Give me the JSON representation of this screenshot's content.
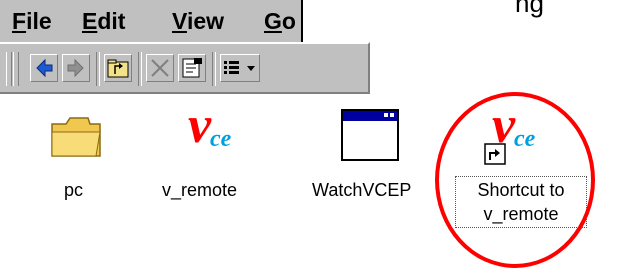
{
  "corner_text": "ng",
  "menu": {
    "items": [
      {
        "label_acc": "F",
        "label_rest": "ile"
      },
      {
        "label_acc": "E",
        "label_rest": "dit"
      },
      {
        "label_acc": "V",
        "label_rest": "iew"
      },
      {
        "label_acc": "G",
        "label_rest": "o"
      }
    ]
  },
  "toolbar": {
    "buttons": [
      "back-icon",
      "forward-icon",
      "up-folder-icon",
      "delete-icon",
      "properties-icon",
      "views-icon"
    ]
  },
  "files": [
    {
      "label": "pc",
      "icon": "folder-icon"
    },
    {
      "label": "v_remote",
      "icon": "vce-app-icon"
    },
    {
      "label": "WatchVCEP",
      "icon": "window-icon"
    },
    {
      "label_line1": "Shortcut to",
      "label_line2": "v_remote",
      "icon": "vce-shortcut-icon",
      "selected": true
    }
  ],
  "vce_logo": {
    "main": "v",
    "sub": "ce"
  },
  "colors": {
    "highlight": "#ff0000",
    "chrome": "#c0c0c0",
    "vce_red": "#ff0000",
    "vce_blue": "#00a0e0",
    "folder": "#f0c850"
  }
}
